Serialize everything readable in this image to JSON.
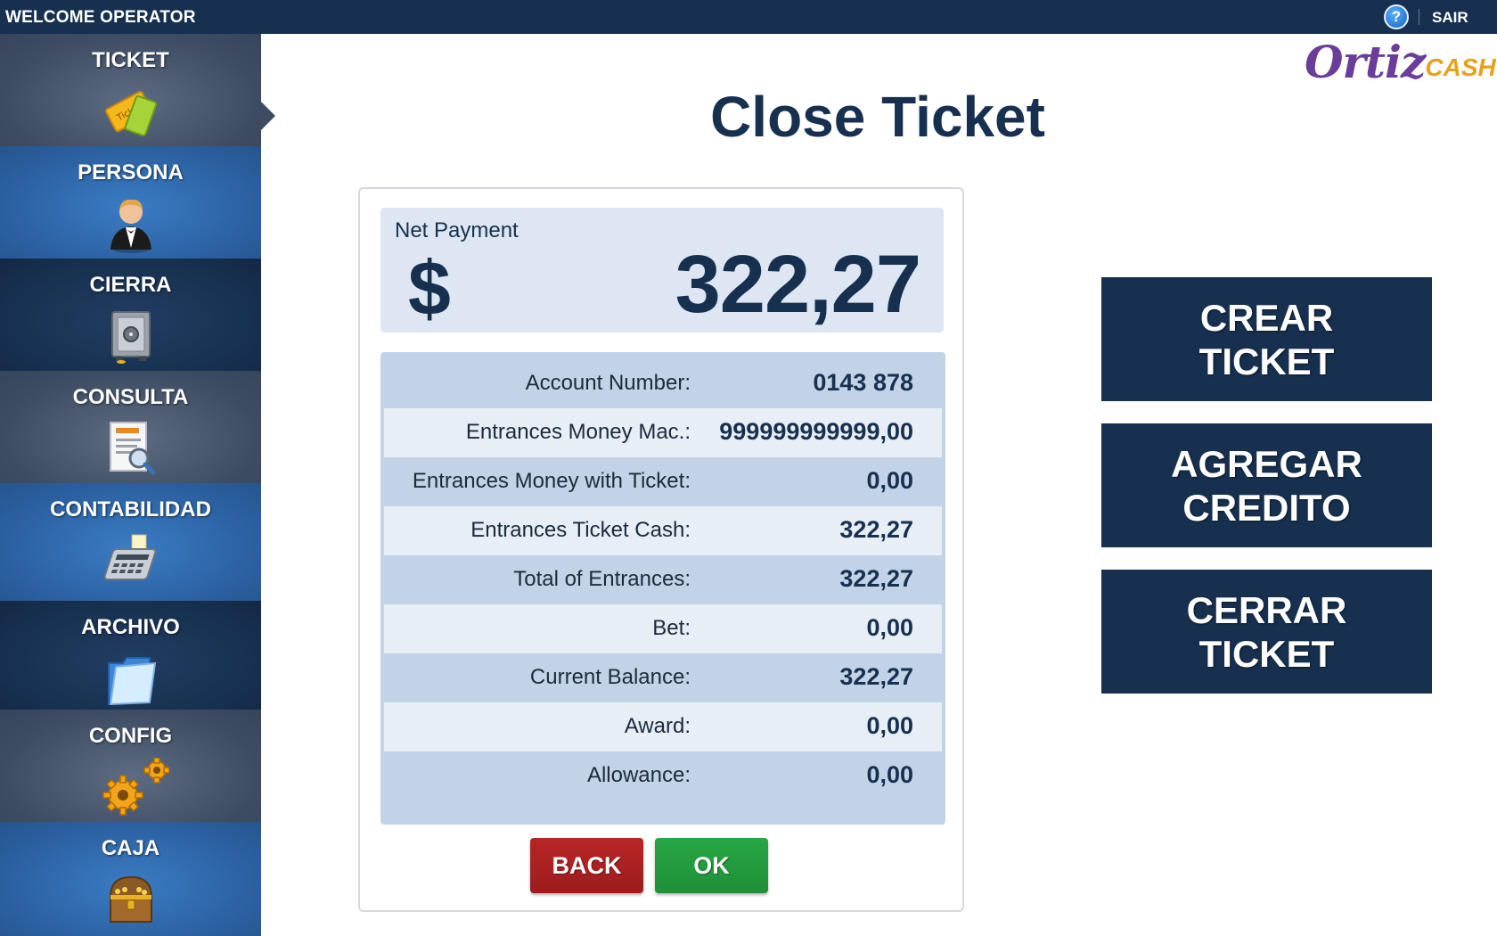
{
  "topbar": {
    "welcome": "WELCOME OPERATOR",
    "help_icon": "help-icon",
    "logout_label": "SAIR"
  },
  "sidebar": {
    "items": [
      {
        "label": "TICKET",
        "icon": "ticket-icon",
        "active": true
      },
      {
        "label": "PERSONA",
        "icon": "person-icon"
      },
      {
        "label": "CIERRA",
        "icon": "safe-icon"
      },
      {
        "label": "CONSULTA",
        "icon": "document-search-icon"
      },
      {
        "label": "CONTABILIDAD",
        "icon": "register-icon"
      },
      {
        "label": "ARCHIVO",
        "icon": "folder-icon"
      },
      {
        "label": "CONFIG",
        "icon": "gears-icon"
      },
      {
        "label": "CAJA",
        "icon": "treasure-chest-icon"
      }
    ]
  },
  "logo": {
    "main": "Ortiz",
    "suffix": "CASH"
  },
  "page": {
    "title": "Close Ticket"
  },
  "net_payment": {
    "label": "Net Payment",
    "currency": "$",
    "amount": "322,27"
  },
  "details": [
    {
      "label": "Account Number:",
      "value": "0143 878"
    },
    {
      "label": "Entrances Money Mac.:",
      "value": "999999999999,00"
    },
    {
      "label": "Entrances Money with Ticket:",
      "value": "0,00"
    },
    {
      "label": "Entrances Ticket Cash:",
      "value": "322,27"
    },
    {
      "label": "Total of Entrances:",
      "value": "322,27"
    },
    {
      "label": "Bet:",
      "value": "0,00"
    },
    {
      "label": "Current Balance:",
      "value": "322,27"
    },
    {
      "label": "Award:",
      "value": "0,00"
    },
    {
      "label": "Allowance:",
      "value": "0,00"
    }
  ],
  "buttons": {
    "back": "BACK",
    "ok": "OK"
  },
  "actions": {
    "crear": "CREAR\nTICKET",
    "agregar": "AGREGAR\nCREDITO",
    "cerrar": "CERRAR\nTICKET"
  },
  "colors": {
    "navy": "#17304f",
    "blue": "#2b5f9f",
    "slate": "#3d4c63",
    "back": "#9d1c1c",
    "ok": "#1f8f38",
    "panel": "#c2d3e8"
  }
}
